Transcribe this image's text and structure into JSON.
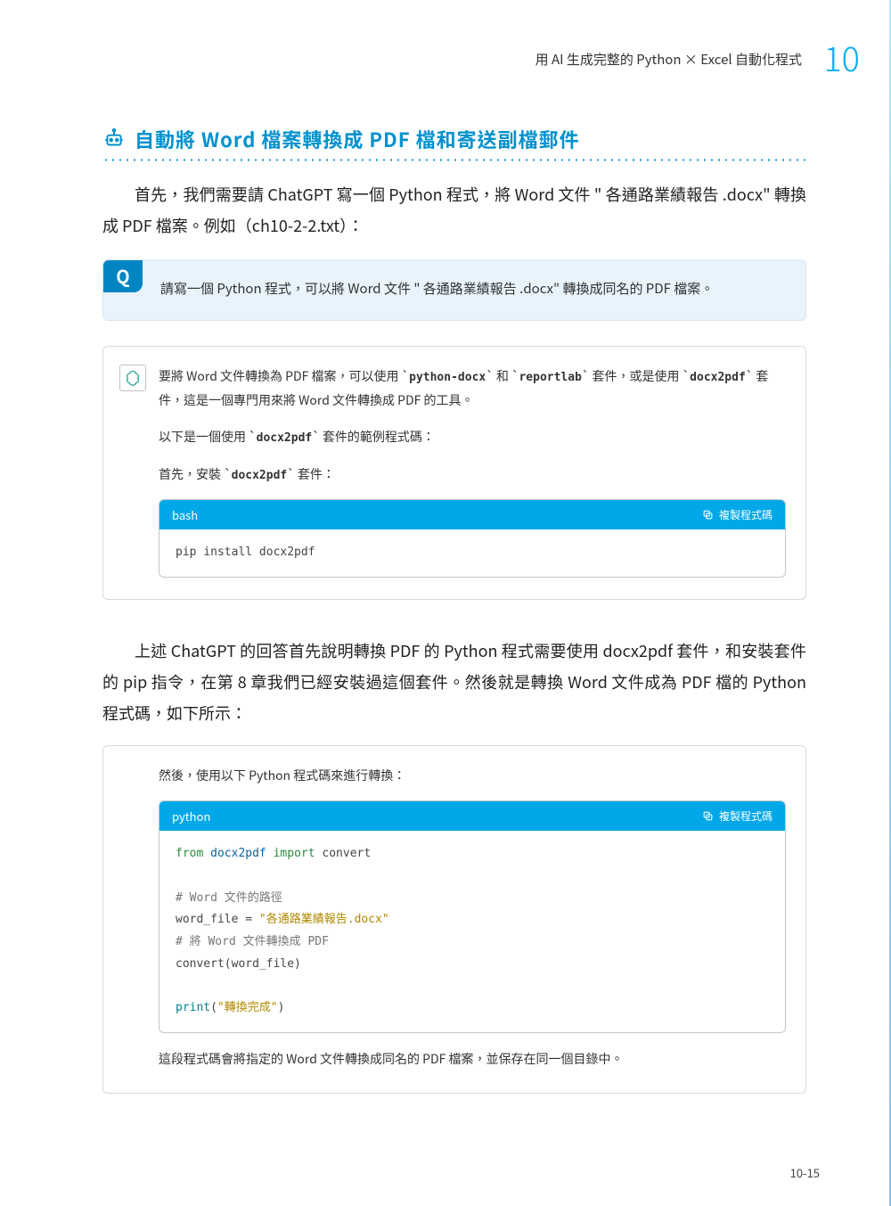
{
  "header": {
    "running_head": "用 AI 生成完整的 Python × Excel 自動化程式",
    "chapter_number": "10"
  },
  "section": {
    "title": "自動將 Word 檔案轉換成 PDF 檔和寄送副檔郵件"
  },
  "paragraphs": {
    "intro": "首先，我們需要請 ChatGPT 寫一個 Python 程式，將 Word 文件 \" 各通路業績報告 .docx\" 轉換成 PDF 檔案。例如（ch10-2-2.txt）：",
    "mid": "上述 ChatGPT 的回答首先說明轉換 PDF 的 Python 程式需要使用 docx2pdf 套件，和安裝套件的 pip 指令，在第 8 章我們已經安裝過這個套件。然後就是轉換 Word 文件成為 PDF 檔的 Python 程式碼，如下所示："
  },
  "prompt": {
    "badge": "Q",
    "text": "請寫一個 Python 程式，可以將 Word 文件 \" 各通路業績報告 .docx\" 轉換成同名的 PDF 檔案。"
  },
  "answer1": {
    "p1_a": "要將 Word 文件轉換為 PDF 檔案，可以使用 `",
    "p1_pkg1": "python-docx",
    "p1_b": "` 和 `",
    "p1_pkg2": "reportlab",
    "p1_c": "` 套件，或是使用 `",
    "p1_pkg3": "docx2pdf",
    "p1_d": "` 套件，這是一個專門用來將 Word 文件轉換成 PDF 的工具。",
    "p2_a": "以下是一個使用 `",
    "p2_pkg": "docx2pdf",
    "p2_b": "` 套件的範例程式碼：",
    "p3_a": "首先，安裝 `",
    "p3_pkg": "docx2pdf",
    "p3_b": "` 套件："
  },
  "code1": {
    "lang": "bash",
    "copy_label": "複製程式碼",
    "content": "pip install docx2pdf"
  },
  "answer2": {
    "p1": "然後，使用以下 Python 程式碼來進行轉換：",
    "footer": "這段程式碼會將指定的 Word 文件轉換成同名的 PDF 檔案，並保存在同一個目錄中。"
  },
  "code2": {
    "lang": "python",
    "copy_label": "複製程式碼",
    "lines": {
      "l1_from": "from",
      "l1_mod": "docx2pdf",
      "l1_import": "import",
      "l1_name": "convert",
      "l3_cmt": "# Word 文件的路徑",
      "l4_a": "word_file = ",
      "l4_str": "\"各通路業績報告.docx\"",
      "l5_cmt": "# 將 Word 文件轉換成 PDF",
      "l6": "convert(word_file)",
      "l8_fn": "print",
      "l8_a": "(",
      "l8_str": "\"轉換完成\"",
      "l8_b": ")"
    }
  },
  "footer": {
    "page": "10-15"
  }
}
